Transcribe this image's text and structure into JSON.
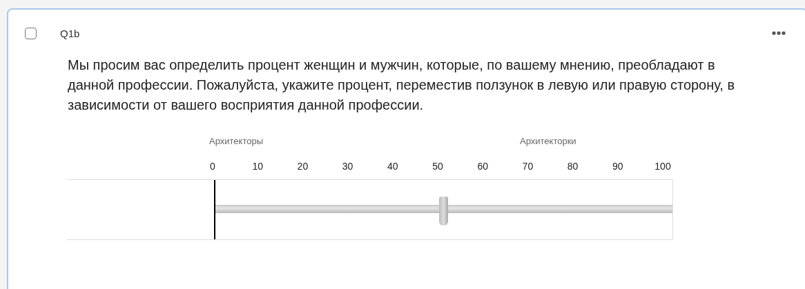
{
  "question": {
    "id": "Q1b",
    "selected": false,
    "text": "Мы просим вас определить процент женщин и мужчин, которые, по вашему мнению, преобладают в данной профессии. Пожалуйста, укажите процент, переместив ползунок в левую или правую сторону, в зависимости от вашего восприятия данной профессии."
  },
  "scale": {
    "left_label": "Архитекторы",
    "right_label": "Архитекторки",
    "ticks": [
      "0",
      "10",
      "20",
      "30",
      "40",
      "50",
      "60",
      "70",
      "80",
      "90",
      "100"
    ]
  },
  "slider": {
    "level": 0.5
  }
}
